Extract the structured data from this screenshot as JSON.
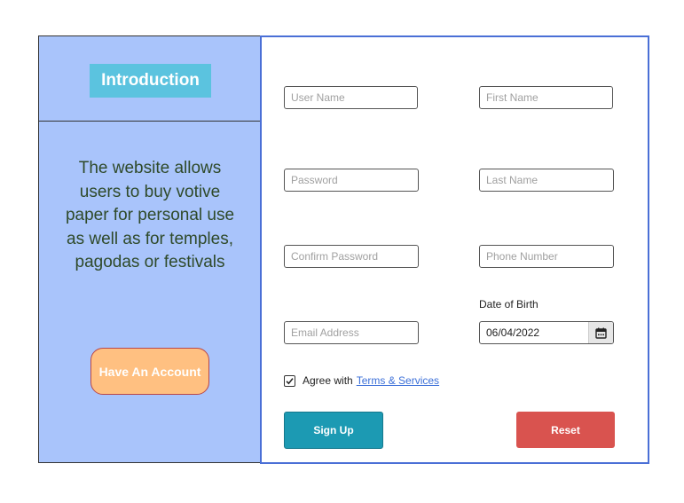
{
  "intro": {
    "title": "Introduction",
    "description": "The website allows users to buy votive paper for personal use as well as for temples, pagodas or festivals",
    "account_button": "Have An Account"
  },
  "form": {
    "username_placeholder": "User Name",
    "first_name_placeholder": "First Name",
    "password_placeholder": "Password",
    "last_name_placeholder": "Last Name",
    "confirm_password_placeholder": "Confirm Password",
    "phone_placeholder": "Phone Number",
    "email_placeholder": "Email Address",
    "dob_label": "Date of Birth",
    "dob_value": "06/04/2022",
    "agree_text": "Agree with",
    "terms_link": "Terms & Services",
    "agree_checked": true,
    "signup_label": "Sign Up",
    "reset_label": "Reset"
  },
  "colors": {
    "left_panel": "#a9c4fb",
    "intro_badge": "#5bc3df",
    "account_button": "#ffc081",
    "signup": "#1c9ab3",
    "reset": "#d9534f",
    "right_border": "#4a6fd6",
    "link": "#3b6fd8"
  },
  "icons": {
    "calendar": "calendar-icon",
    "checkbox": "checkmark-icon"
  }
}
